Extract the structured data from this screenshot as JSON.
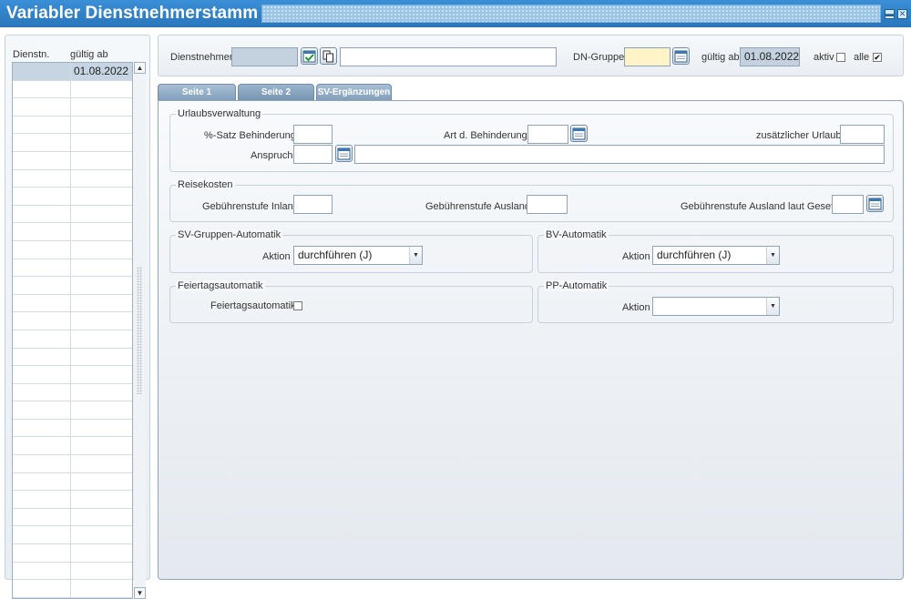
{
  "window": {
    "title": "Variabler Dienstnehmerstamm",
    "minimize_glyph": "▬",
    "close_glyph": "✕"
  },
  "list": {
    "col1_header": "Dienstn.",
    "col2_header": "gültig ab",
    "rows": [
      {
        "dienstn": "",
        "gueltig_ab": "01.08.2022"
      }
    ],
    "scroll_up_glyph": "▲",
    "scroll_down_glyph": "▼"
  },
  "header": {
    "dienstnehmer_label": "Dienstnehmer",
    "dienstnehmer_value": "",
    "dienstnehmer_name": "",
    "dn_gruppe_label": "DN-Gruppe",
    "dn_gruppe_value": "",
    "gueltig_ab_label": "gültig ab",
    "gueltig_ab_value": "01.08.2022",
    "aktiv_label": "aktiv",
    "aktiv_checked": false,
    "alle_label": "alle",
    "alle_checked": true,
    "checked_glyph": "✔"
  },
  "tabs": [
    {
      "label": "Seite 1"
    },
    {
      "label": "Seite 2"
    },
    {
      "label": "SV-Ergänzungen"
    }
  ],
  "urlaub": {
    "title": "Urlaubsverwaltung",
    "prozent_label": "%-Satz Behinderung",
    "art_label": "Art d. Behinderung",
    "zusatz_label": "zusätzlicher Urlaub",
    "anspruch_label": "Anspruch"
  },
  "reise": {
    "title": "Reisekosten",
    "inland_label": "Gebührenstufe Inland",
    "ausland_label": "Gebührenstufe Ausland",
    "gesetz_label": "Gebührenstufe Ausland laut Gesetz"
  },
  "sv_auto": {
    "title": "SV-Gruppen-Automatik",
    "aktion_label": "Aktion",
    "aktion_value": "durchführen (J)"
  },
  "bv_auto": {
    "title": "BV-Automatik",
    "aktion_label": "Aktion",
    "aktion_value": "durchführen (J)"
  },
  "feiertag": {
    "title": "Feiertagsautomatik",
    "check_label": "Feiertagsautomatik"
  },
  "pp_auto": {
    "title": "PP-Automatik",
    "aktion_label": "Aktion",
    "aktion_value": ""
  },
  "colors": {
    "titlebar": "#2f82c8",
    "tab": "#7f9db9",
    "selected_row": "#c7d5e3",
    "readonly_field": "#c4d2e0",
    "required_field": "#fff3c8"
  }
}
